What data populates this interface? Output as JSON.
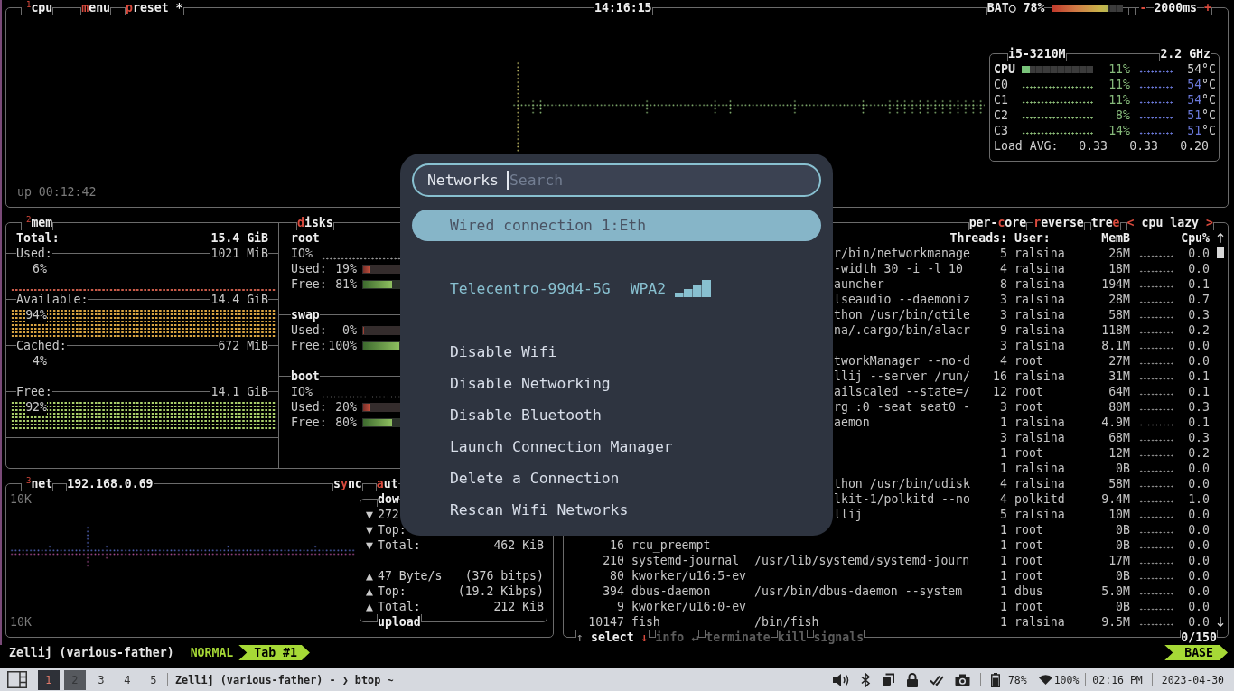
{
  "cpu_box": {
    "number": "1",
    "title": "cpu",
    "toggles": [
      {
        "key": "m",
        "after": "enu"
      },
      {
        "key": "p",
        "after": "reset *"
      }
    ],
    "clock": "14:16:15",
    "battery": {
      "label": "BAT○",
      "percent": "78%",
      "level": 0.78
    },
    "interval": {
      "minus": "-",
      "value": "2000ms",
      "plus": "+"
    },
    "uptime": "up 00:12:42",
    "info": {
      "model": "i5-3210M",
      "frequency": "2.2 GHz",
      "rows": [
        {
          "kind": "total",
          "label": "CPU",
          "level": 0.11,
          "percent": "11%",
          "temp": "54",
          "unit": "°C"
        },
        {
          "kind": "core",
          "label": "C0",
          "percent": "11%",
          "temp": "54",
          "unit": "°C"
        },
        {
          "kind": "core",
          "label": "C1",
          "percent": "11%",
          "temp": "54",
          "unit": "°C"
        },
        {
          "kind": "core",
          "label": "C2",
          "percent": "8%",
          "temp": "51",
          "unit": "°C"
        },
        {
          "kind": "core",
          "label": "C3",
          "percent": "14%",
          "temp": "51",
          "unit": "°C"
        }
      ],
      "load_label": "Load AVG:",
      "load": [
        "0.33",
        "0.33",
        "0.20"
      ]
    }
  },
  "mem_box": {
    "number": "2",
    "title": "mem",
    "rows": [
      {
        "kind": "total",
        "label": "Total:",
        "value": "15.4 GiB"
      },
      {
        "kind": "used",
        "label": "Used:",
        "value": "1021 MiB",
        "percent": "6%"
      },
      {
        "kind": "available",
        "label": "Available:",
        "value": "14.4 GiB",
        "percent": "94%"
      },
      {
        "kind": "cached",
        "label": "Cached:",
        "value": "672 MiB",
        "percent": "4%"
      },
      {
        "kind": "free",
        "label": "Free:",
        "value": "14.1 GiB",
        "percent": "92%"
      }
    ]
  },
  "disks": {
    "title": {
      "key": "d",
      "after": "isks"
    },
    "mounts": [
      {
        "name": "root",
        "io_label": "IO%",
        "bars": [
          {
            "kind": "used",
            "label": "Used:",
            "percent": "19%",
            "level": 0.19
          },
          {
            "kind": "free",
            "label": "Free:",
            "percent": "81%",
            "level": 0.81
          }
        ]
      },
      {
        "name": "swap",
        "bars": [
          {
            "kind": "used",
            "label": "Used:",
            "percent": "0%",
            "level": 0
          },
          {
            "kind": "free",
            "label": "Free:",
            "percent": "100%",
            "level": 1
          }
        ]
      },
      {
        "name": "boot",
        "io_label": "IO%",
        "bars": [
          {
            "kind": "used",
            "label": "Used:",
            "percent": "20%",
            "level": 0.2
          },
          {
            "kind": "free",
            "label": "Free:",
            "percent": "80%",
            "level": 0.8
          }
        ]
      }
    ]
  },
  "net_box": {
    "number": "3",
    "title": "net",
    "address": "192.168.0.69",
    "toggles": [
      {
        "before": "s",
        "key": "y",
        "after": "nc"
      },
      {
        "key": "a",
        "after": "ut"
      }
    ],
    "scale_top": "10K",
    "scale_bottom": "10K",
    "download": {
      "label": "dow",
      "rows": [
        {
          "arrow": "▼",
          "label": "272"
        },
        {
          "arrow": "▼",
          "label": "Top:"
        },
        {
          "arrow": "▼",
          "label": "Total:",
          "value": "462 KiB"
        }
      ]
    },
    "upload": {
      "label": "upload",
      "rows": [
        {
          "arrow": "▲",
          "label": "47 Byte/s",
          "value": "(376 bitps)"
        },
        {
          "arrow": "▲",
          "label": "Top:",
          "value": "(19.2 Kibps)"
        },
        {
          "arrow": "▲",
          "label": "Total:",
          "value": "212 KiB"
        }
      ]
    }
  },
  "proc_box": {
    "toggles": [
      {
        "before": "per-",
        "key": "c",
        "after": "ore"
      },
      {
        "key": "r",
        "after": "everse"
      },
      {
        "before": "tre",
        "key": "e"
      }
    ],
    "sort": {
      "prev": "<",
      "label": "cpu lazy",
      "next": ">"
    },
    "columns": [
      "Threads:",
      "User:",
      "MemB",
      "Cpu%"
    ],
    "rows": [
      {
        "command": "r/bin/networkmanage",
        "threads": "5",
        "user": "ralsina",
        "mem": "26M",
        "cpu": "0.0"
      },
      {
        "command": "-width 30 -i -l 10",
        "threads": "4",
        "user": "ralsina",
        "mem": "18M",
        "cpu": "0.0"
      },
      {
        "command": "auncher",
        "threads": "8",
        "user": "ralsina",
        "mem": "194M",
        "cpu": "0.1"
      },
      {
        "command": "lseaudio --daemoniz",
        "threads": "3",
        "user": "ralsina",
        "mem": "28M",
        "cpu": "0.7"
      },
      {
        "command": "thon /usr/bin/qtile",
        "threads": "3",
        "user": "ralsina",
        "mem": "58M",
        "cpu": "0.3"
      },
      {
        "command": "na/.cargo/bin/alacr",
        "threads": "9",
        "user": "ralsina",
        "mem": "118M",
        "cpu": "0.2"
      },
      {
        "threads": "3",
        "user": "ralsina",
        "mem": "8.1M",
        "cpu": "0.0"
      },
      {
        "command": "tworkManager --no-d",
        "threads": "4",
        "user": "root",
        "mem": "27M",
        "cpu": "0.0"
      },
      {
        "command": "llij --server /run/",
        "threads": "16",
        "user": "ralsina",
        "mem": "31M",
        "cpu": "0.1"
      },
      {
        "command": "ailscaled --state=/",
        "threads": "12",
        "user": "root",
        "mem": "64M",
        "cpu": "0.1"
      },
      {
        "command": "rg :0 -seat seat0 -",
        "threads": "3",
        "user": "root",
        "mem": "80M",
        "cpu": "0.3"
      },
      {
        "command": "aemon",
        "threads": "1",
        "user": "ralsina",
        "mem": "4.9M",
        "cpu": "0.1"
      },
      {
        "threads": "3",
        "user": "ralsina",
        "mem": "68M",
        "cpu": "0.3"
      },
      {
        "threads": "1",
        "user": "root",
        "mem": "12M",
        "cpu": "0.2"
      },
      {
        "threads": "1",
        "user": "ralsina",
        "mem": "0B",
        "cpu": "0.0"
      },
      {
        "command": "thon /usr/bin/udisk",
        "threads": "4",
        "user": "ralsina",
        "mem": "58M",
        "cpu": "0.0"
      },
      {
        "command": "lkit-1/polkitd --no",
        "threads": "4",
        "user": "polkitd",
        "mem": "9.4M",
        "cpu": "1.0"
      },
      {
        "command": "llij",
        "threads": "5",
        "user": "ralsina",
        "mem": "10M",
        "cpu": "0.0"
      },
      {
        "threads": "1",
        "user": "root",
        "mem": "0B",
        "cpu": "0.0"
      },
      {
        "pid": "16",
        "program": "rcu_preempt",
        "threads": "1",
        "user": "root",
        "mem": "0B",
        "cpu": "0.0"
      },
      {
        "pid": "210",
        "program": "systemd-journal",
        "command": "/usr/lib/systemd/systemd-journ",
        "threads": "1",
        "user": "root",
        "mem": "17M",
        "cpu": "0.0"
      },
      {
        "pid": "80",
        "program": "kworker/u16:5-ev",
        "threads": "1",
        "user": "root",
        "mem": "0B",
        "cpu": "0.0"
      },
      {
        "pid": "394",
        "program": "dbus-daemon",
        "command": "/usr/bin/dbus-daemon --system",
        "threads": "1",
        "user": "dbus",
        "mem": "5.0M",
        "cpu": "0.0"
      },
      {
        "pid": "9",
        "program": "kworker/u16:0-ev",
        "threads": "1",
        "user": "root",
        "mem": "0B",
        "cpu": "0.0"
      },
      {
        "pid": "10147",
        "program": "fish",
        "command": "/bin/fish",
        "threads": "1",
        "user": "ralsina",
        "mem": "9.5M",
        "cpu": "0.0"
      }
    ],
    "footer": [
      {
        "pre": "↑",
        "label": "select",
        "post": "↓",
        "disabled": false
      },
      {
        "label": "info",
        "post": "↵",
        "disabled": true
      },
      {
        "label": "terminate",
        "disabled": true
      },
      {
        "label": "kill",
        "disabled": true
      },
      {
        "label": "signals",
        "disabled": true
      }
    ],
    "count": "0/150"
  },
  "rofi": {
    "prompt": "Networks",
    "placeholder": "Search",
    "entries": [
      {
        "kind": "wired",
        "label": "Wired connection 1:Eth",
        "selected": true
      },
      {
        "kind": "wifi",
        "label": "Telecentro-99d4-5G",
        "security": "WPA2",
        "selected": false
      },
      {
        "kind": "action",
        "label": "Disable Wifi",
        "selected": false
      },
      {
        "kind": "action",
        "label": "Disable Networking",
        "selected": false
      },
      {
        "kind": "action",
        "label": "Disable Bluetooth",
        "selected": false
      },
      {
        "kind": "action",
        "label": "Launch Connection Manager",
        "selected": false
      },
      {
        "kind": "action",
        "label": "Delete a Connection",
        "selected": false
      },
      {
        "kind": "action",
        "label": "Rescan Wifi Networks",
        "selected": false
      }
    ]
  },
  "zellij_bar": {
    "session": "Zellij (various-father)",
    "mode": "NORMAL",
    "tabs": [
      {
        "label": "Tab #1",
        "selected": true
      }
    ],
    "layout": "BASE"
  },
  "taskbar": {
    "workspaces": [
      {
        "label": "1",
        "selected": true,
        "occupied": true
      },
      {
        "label": "2",
        "selected": false,
        "occupied": true
      },
      {
        "label": "3",
        "selected": false,
        "occupied": false
      },
      {
        "label": "4",
        "selected": false,
        "occupied": false
      },
      {
        "label": "5",
        "selected": false,
        "occupied": false
      }
    ],
    "window_title": "Zellij (various-father) - ❯ btop ~",
    "tray": [
      {
        "kind": "volume"
      },
      {
        "kind": "bluetooth"
      },
      {
        "kind": "clipboard"
      },
      {
        "kind": "lock"
      },
      {
        "kind": "checklist"
      },
      {
        "kind": "camera"
      }
    ],
    "battery": "78%",
    "wifi": "100%",
    "time": "02:16 PM",
    "date": "2023-04-30"
  }
}
